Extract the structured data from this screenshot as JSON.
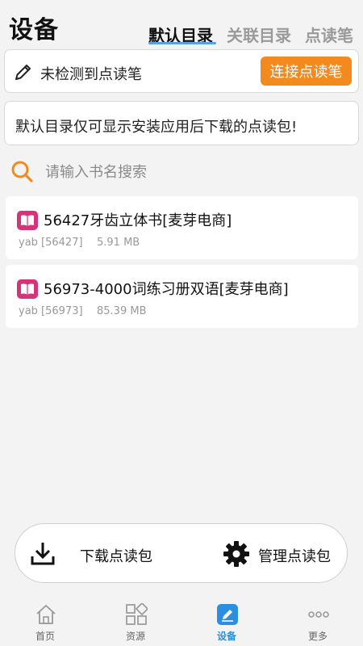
{
  "header": {
    "title": "设备",
    "tabs": [
      {
        "label": "默认目录",
        "active": true
      },
      {
        "label": "关联目录",
        "active": false
      },
      {
        "label": "点读笔",
        "active": false
      }
    ]
  },
  "pen": {
    "status": "未检测到点读笔",
    "connect_label": "连接点读笔"
  },
  "notice": "默认目录仅可显示安装应用后下载的点读包!",
  "search": {
    "placeholder": "请输入书名搜索",
    "value": ""
  },
  "books": [
    {
      "title": "56427牙齿立体书[麦芽电商]",
      "format": "yab [56427]",
      "size": "5.91 MB"
    },
    {
      "title": "56973-4000词练习册双语[麦芽电商]",
      "format": "yab [56973]",
      "size": "85.39 MB"
    }
  ],
  "actions": {
    "download_label": "下载点读包",
    "manage_label": "管理点读包"
  },
  "nav": [
    {
      "label": "首页",
      "icon": "home-icon",
      "active": false
    },
    {
      "label": "资源",
      "icon": "apps-icon",
      "active": false
    },
    {
      "label": "设备",
      "icon": "device-icon",
      "active": true
    },
    {
      "label": "更多",
      "icon": "more-icon",
      "active": false
    }
  ],
  "colors": {
    "accent_orange": "#f28a1e",
    "accent_blue": "#2a8fe0",
    "book_icon_pink": "#d6337a",
    "tab_underline": "#5aa0e6"
  }
}
